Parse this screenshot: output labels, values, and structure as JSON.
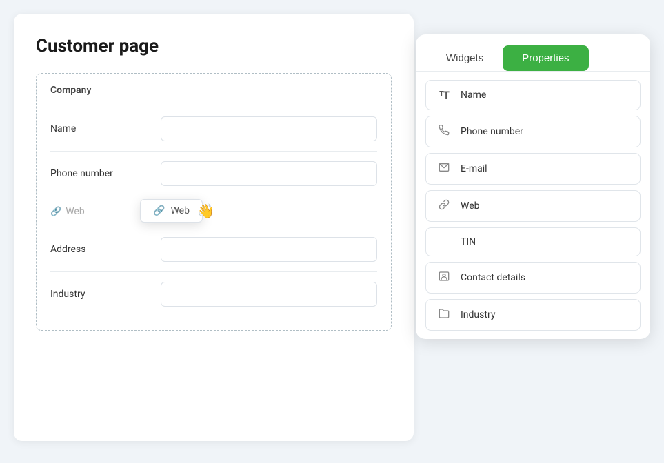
{
  "page": {
    "title": "Customer page"
  },
  "main_panel": {
    "section_label": "Company",
    "fields": [
      {
        "id": "name",
        "label": "Name",
        "type": "text"
      },
      {
        "id": "phone",
        "label": "Phone number",
        "type": "text"
      },
      {
        "id": "web",
        "label": "Web",
        "type": "web"
      },
      {
        "id": "address",
        "label": "Address",
        "type": "text"
      },
      {
        "id": "industry",
        "label": "Industry",
        "type": "text"
      }
    ]
  },
  "right_panel": {
    "tabs": [
      {
        "id": "widgets",
        "label": "Widgets",
        "active": false
      },
      {
        "id": "properties",
        "label": "Properties",
        "active": true
      }
    ],
    "widgets": [
      {
        "id": "name",
        "label": "Name",
        "icon": "text-icon"
      },
      {
        "id": "phone",
        "label": "Phone number",
        "icon": "phone-icon"
      },
      {
        "id": "email",
        "label": "E-mail",
        "icon": "email-icon"
      },
      {
        "id": "web",
        "label": "Web",
        "icon": "link-icon"
      },
      {
        "id": "tin",
        "label": "TIN",
        "icon": "tin-icon"
      },
      {
        "id": "contact",
        "label": "Contact details",
        "icon": "contact-icon"
      },
      {
        "id": "industry",
        "label": "Industry",
        "icon": "folder-icon"
      }
    ]
  },
  "drag_preview": {
    "label": "Web"
  },
  "icons": {
    "text": "ᵀ",
    "phone": "☎",
    "email": "✉",
    "link": "🔗",
    "tin": "",
    "contact": "👤",
    "folder": "🗂"
  }
}
